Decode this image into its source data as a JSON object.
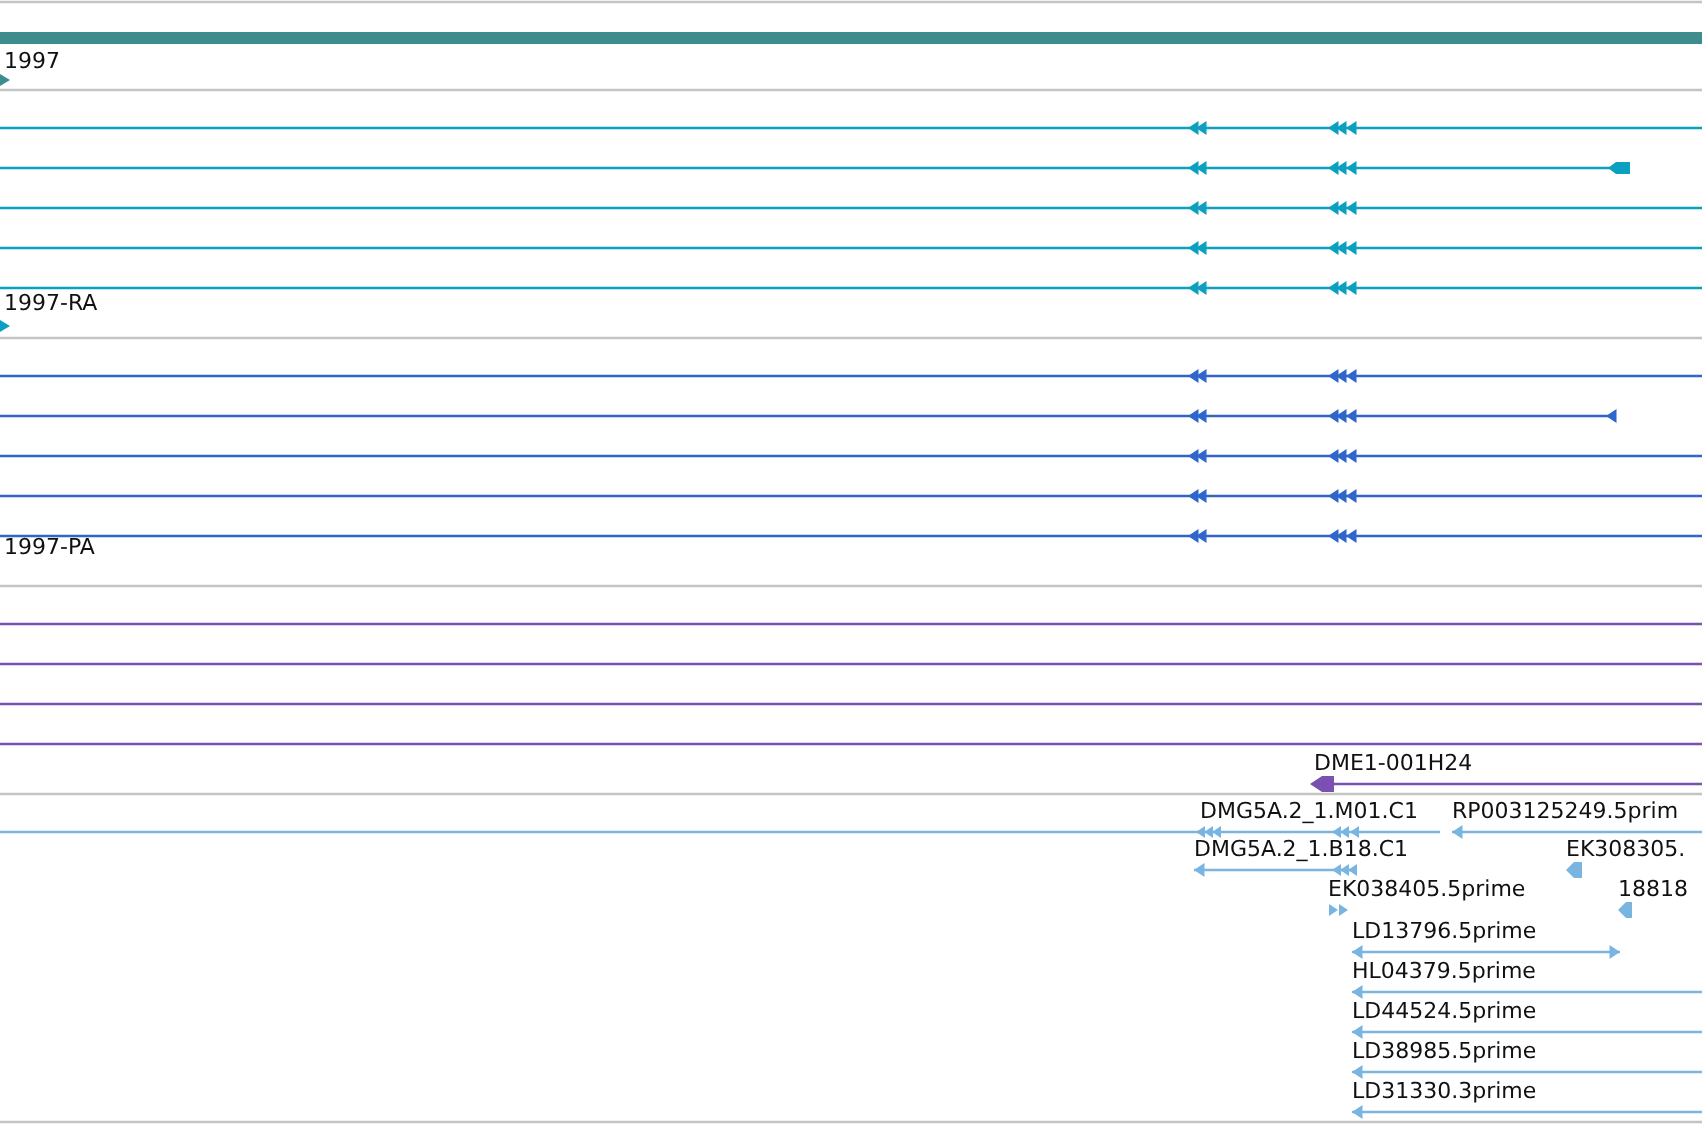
{
  "tracks": [
    {
      "kind": "gene",
      "color": "#3d8d8d",
      "label": "1997"
    },
    {
      "kind": "transcript",
      "color": "#0aa0c0",
      "label": "1997-RA",
      "rows": [
        {
          "kind": "through"
        },
        {
          "kind": "end"
        },
        {
          "kind": "through"
        },
        {
          "kind": "through"
        },
        {
          "kind": "through"
        }
      ]
    },
    {
      "kind": "transcript",
      "color": "#2f66cc",
      "label": "1997-PA",
      "rows": [
        {
          "kind": "through"
        },
        {
          "kind": "end"
        },
        {
          "kind": "through"
        },
        {
          "kind": "through"
        },
        {
          "kind": "through"
        }
      ]
    },
    {
      "kind": "clone",
      "color": "#7a50b0",
      "label": "DME1-001H24",
      "rows": [
        {
          "kind": "through"
        },
        {
          "kind": "through"
        },
        {
          "kind": "through"
        },
        {
          "kind": "through"
        }
      ]
    },
    {
      "kind": "est",
      "color": "#7ab4e0",
      "rows": [
        [
          {
            "label": "DMG5A.2_1.M01.C1"
          },
          {
            "label": "RP003125249.5prim"
          }
        ],
        [
          {
            "label": "DMG5A.2_1.B18.C1"
          },
          {
            "label": "EK308305."
          }
        ],
        [
          {
            "label": "EK038405.5prime"
          },
          {
            "label": "18818"
          }
        ],
        [
          {
            "label": "LD13796.5prime"
          }
        ],
        [
          {
            "label": "HL04379.5prime"
          }
        ],
        [
          {
            "label": "LD44524.5prime"
          }
        ],
        [
          {
            "label": "LD38985.5prime"
          }
        ],
        [
          {
            "label": "LD31330.3prime"
          }
        ]
      ]
    }
  ]
}
